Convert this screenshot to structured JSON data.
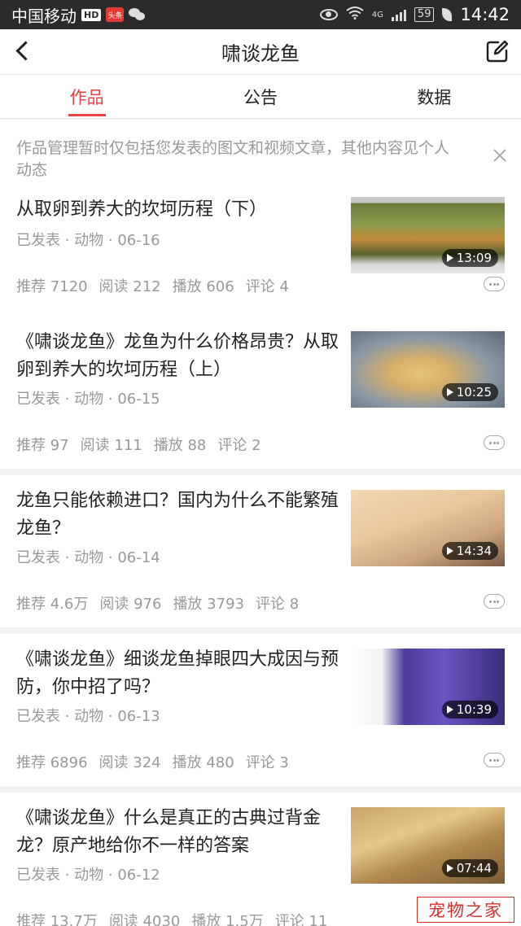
{
  "status_bar": {
    "carrier": "中国移动",
    "hd_badge": "HD",
    "app_badge": "头条",
    "network": "4G",
    "battery": "59",
    "time": "14:42"
  },
  "nav": {
    "title": "啸谈龙鱼"
  },
  "tabs": [
    {
      "label": "作品",
      "active": true
    },
    {
      "label": "公告",
      "active": false
    },
    {
      "label": "数据",
      "active": false
    }
  ],
  "notice": {
    "text": "作品管理暂时仅包括您发表的图文和视频文章，其他内容见个人动态"
  },
  "articles": [
    {
      "title": "从取卵到养大的坎坷历程（下）",
      "meta": "已发表 · 动物 · 06-16",
      "duration": "13:09",
      "stats": [
        "推荐 7120",
        "阅读 212",
        "播放 606",
        "评论 4"
      ]
    },
    {
      "title": "《啸谈龙鱼》龙鱼为什么价格昂贵？从取卵到养大的坎坷历程（上）",
      "meta": "已发表 · 动物 · 06-15",
      "duration": "10:25",
      "stats": [
        "推荐 97",
        "阅读 111",
        "播放 88",
        "评论 2"
      ]
    },
    {
      "title": "龙鱼只能依赖进口？国内为什么不能繁殖龙鱼？",
      "meta": "已发表 · 动物 · 06-14",
      "duration": "14:34",
      "stats": [
        "推荐 4.6万",
        "阅读 976",
        "播放 3793",
        "评论 8"
      ]
    },
    {
      "title": "《啸谈龙鱼》细谈龙鱼掉眼四大成因与预防，你中招了吗？",
      "meta": "已发表 · 动物 · 06-13",
      "duration": "10:39",
      "stats": [
        "推荐 6896",
        "阅读 324",
        "播放 480",
        "评论 3"
      ]
    },
    {
      "title": "《啸谈龙鱼》什么是真正的古典过背金龙？原产地给你不一样的答案",
      "meta": "已发表 · 动物 · 06-12",
      "duration": "07:44",
      "stats": [
        "推荐 13.7万",
        "阅读 4030",
        "播放 1.5万",
        "评论 11"
      ]
    }
  ],
  "watermark": "宠物之家"
}
